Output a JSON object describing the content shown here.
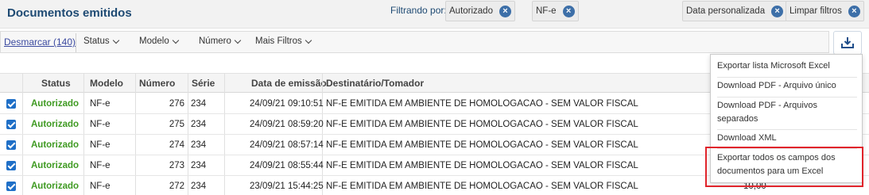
{
  "header": {
    "title": "Documentos emitidos",
    "filter_label": "Filtrando por:",
    "chips": [
      {
        "label": "Autorizado"
      },
      {
        "label": "NF-e"
      },
      {
        "label": "Data personalizada"
      },
      {
        "label": "Limpar filtros"
      }
    ]
  },
  "toolbar": {
    "desmarcar": "Desmarcar (140)",
    "filters": [
      "Status",
      "Modelo",
      "Número",
      "Mais Filtros"
    ]
  },
  "table": {
    "columns": [
      "Status",
      "Modelo",
      "Número",
      "Série",
      "Data de emissão",
      "Destinatário/Tomador"
    ],
    "rows": [
      {
        "status": "Autorizado",
        "modelo": "NF-e",
        "numero": "276",
        "serie": "234",
        "data": "24/09/21 09:10:51",
        "destinatario": "NF-E EMITIDA EM AMBIENTE DE HOMOLOGACAO - SEM VALOR FISCAL"
      },
      {
        "status": "Autorizado",
        "modelo": "NF-e",
        "numero": "275",
        "serie": "234",
        "data": "24/09/21 08:59:20",
        "destinatario": "NF-E EMITIDA EM AMBIENTE DE HOMOLOGACAO - SEM VALOR FISCAL"
      },
      {
        "status": "Autorizado",
        "modelo": "NF-e",
        "numero": "274",
        "serie": "234",
        "data": "24/09/21 08:57:14",
        "destinatario": "NF-E EMITIDA EM AMBIENTE DE HOMOLOGACAO - SEM VALOR FISCAL"
      },
      {
        "status": "Autorizado",
        "modelo": "NF-e",
        "numero": "273",
        "serie": "234",
        "data": "24/09/21 08:55:44",
        "destinatario": "NF-E EMITIDA EM AMBIENTE DE HOMOLOGACAO - SEM VALOR FISCAL"
      },
      {
        "status": "Autorizado",
        "modelo": "NF-e",
        "numero": "272",
        "serie": "234",
        "data": "23/09/21 15:44:25",
        "destinatario": "NF-E EMITIDA EM AMBIENTE DE HOMOLOGACAO - SEM VALOR FISCAL"
      }
    ],
    "partial_value": "10,00"
  },
  "export_menu": {
    "items": [
      "Exportar lista Microsoft Excel",
      "Download PDF - Arquivo único",
      "Download PDF - Arquivos separados",
      "Download XML",
      "Exportar todos os campos dos documentos para um Excel"
    ]
  },
  "icons": {
    "export": "download-tray-icon",
    "chip_remove": "close-circle-icon",
    "dropdown": "chevron-down-icon"
  },
  "colors": {
    "title": "#1e4a73",
    "status_ok": "#3f9a22",
    "checkbox": "#1f6fc7",
    "chip_close": "#3d6fa8",
    "highlight": "#e0242b"
  }
}
